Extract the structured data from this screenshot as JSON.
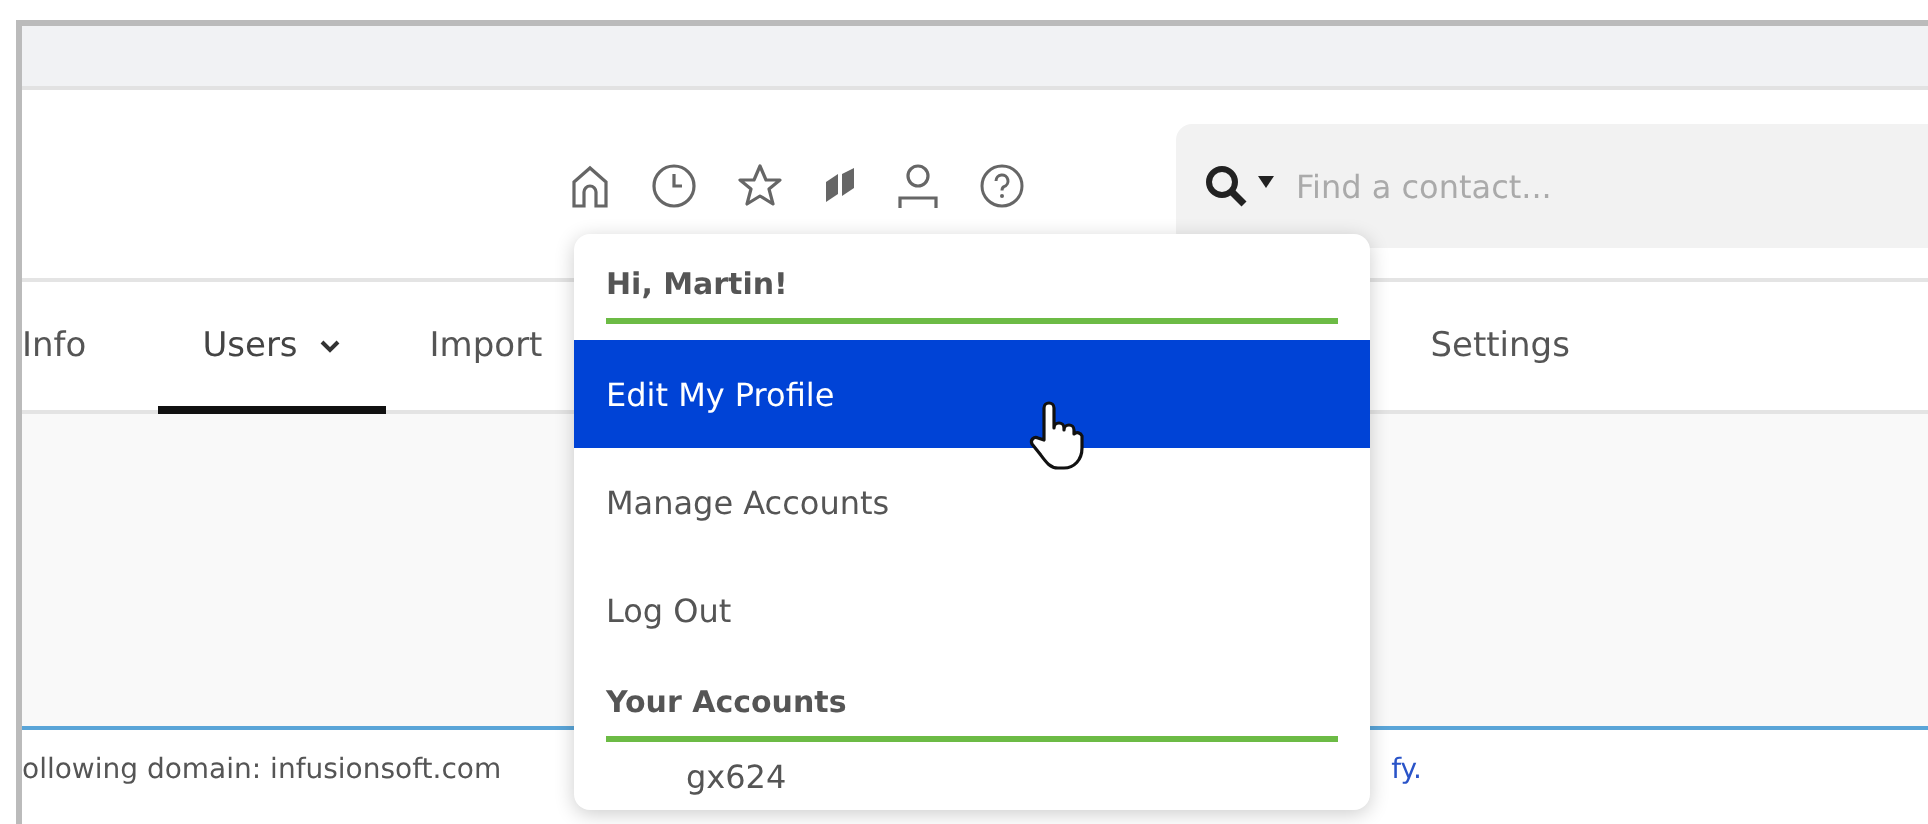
{
  "toolbar": {
    "search": {
      "placeholder": "Find a contact..."
    }
  },
  "tabs": [
    {
      "label": "Info",
      "selected": false,
      "dropdown": false
    },
    {
      "label": "Users",
      "selected": true,
      "dropdown": true
    },
    {
      "label": "Import",
      "selected": false,
      "dropdown": false
    },
    {
      "label": "Settings",
      "selected": false,
      "dropdown": false
    }
  ],
  "notice": {
    "text": "ollowing domain: infusionsoft.com",
    "link": "fy."
  },
  "user_menu": {
    "items": [
      {
        "kind": "header",
        "label": "Hi, Martin!"
      },
      {
        "kind": "item",
        "label": "Edit My Profile",
        "selected": true
      },
      {
        "kind": "item",
        "label": "Manage Accounts",
        "selected": false
      },
      {
        "kind": "item",
        "label": "Log Out",
        "selected": false
      },
      {
        "kind": "header",
        "label": "Your Accounts"
      },
      {
        "kind": "item",
        "label": "gx624",
        "selected": false
      }
    ]
  }
}
